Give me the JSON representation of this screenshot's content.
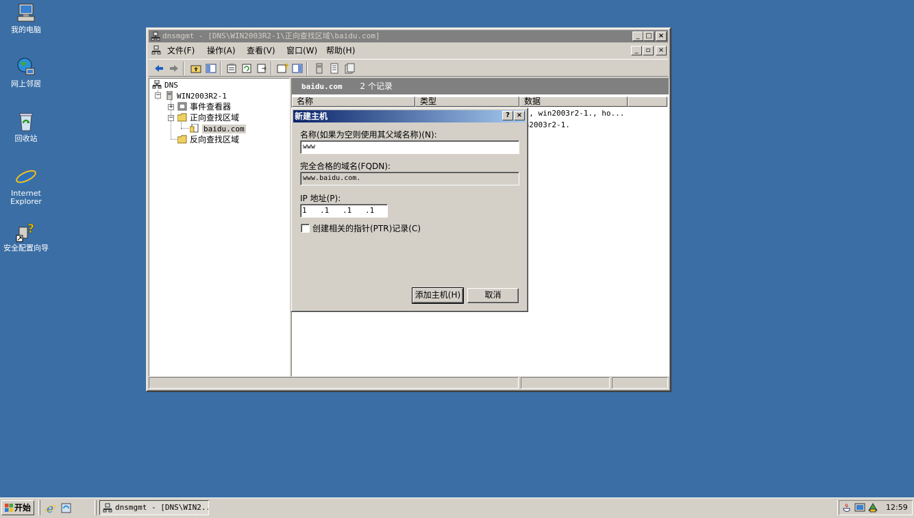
{
  "desktop": {
    "icons": [
      {
        "label": "我的电脑"
      },
      {
        "label": "网上邻居"
      },
      {
        "label": "回收站"
      },
      {
        "label": "Internet Explorer"
      },
      {
        "label": "安全配置向导"
      }
    ]
  },
  "mmc": {
    "title": "dnsmgmt - [DNS\\WIN2003R2-1\\正向查找区域\\baidu.com]",
    "menu": [
      "文件(F)",
      "操作(A)",
      "查看(V)",
      "窗口(W)",
      "帮助(H)"
    ],
    "tree": {
      "root": "DNS",
      "server": "WIN2003R2-1",
      "event_viewer": "事件查看器",
      "forward_zones": "正向查找区域",
      "zone": "baidu.com",
      "reverse_zones": "反向查找区域"
    },
    "right_header": {
      "zone": "baidu.com",
      "count": "2 个记录"
    },
    "columns": [
      "名称",
      "类型",
      "数据"
    ],
    "rows_visible": [
      {
        "data": "1], win2003r2-1., ho..."
      },
      {
        "data": "in2003r2-1."
      }
    ]
  },
  "dialog": {
    "title": "新建主机",
    "name_label": "名称(如果为空则使用其父域名称)(N):",
    "name_value": "www",
    "fqdn_label": "完全合格的域名(FQDN):",
    "fqdn_value": "www.baidu.com.",
    "ip_label": "IP 地址(P):",
    "ip_segments": [
      "1",
      ".1",
      ".1",
      ".1"
    ],
    "ptr_label": "创建相关的指针(PTR)记录(C)",
    "ptr_checked": false,
    "add_button": "添加主机(H)",
    "cancel_button": "取消"
  },
  "taskbar": {
    "start": "开始",
    "task_label": "dnsmgmt - [DNS\\WIN2...",
    "clock": "12:59"
  }
}
